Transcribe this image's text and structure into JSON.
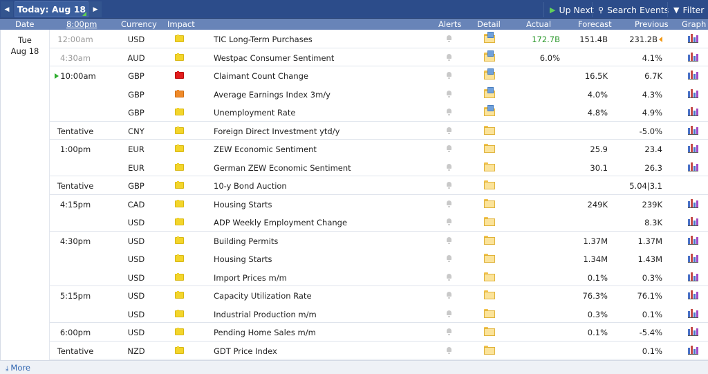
{
  "toolbar": {
    "prev_icon": "chevron-left-icon",
    "next_icon": "chevron-right-icon",
    "today_label": "Today: Aug 18",
    "up_next_label": "Up Next",
    "search_label": "Search Events",
    "filter_label": "Filter"
  },
  "header": {
    "date": "Date",
    "time": "8:00pm",
    "currency": "Currency",
    "impact": "Impact",
    "alerts": "Alerts",
    "detail": "Detail",
    "actual": "Actual",
    "forecast": "Forecast",
    "previous": "Previous",
    "graph": "Graph"
  },
  "day": {
    "weekday": "Tue",
    "date": "Aug 18"
  },
  "colors": {
    "impact_low": "#f3d52b",
    "impact_medium": "#ef8a2a",
    "impact_high": "#e21d1d",
    "actual_better": "#2f9a2f"
  },
  "events": [
    {
      "time": "12:00am",
      "time_muted": true,
      "currency": "USD",
      "impact": "low",
      "event": "TIC Long-Term Purchases",
      "detail": "doc",
      "actual": "172.7B",
      "actual_color": "green",
      "forecast": "151.4B",
      "previous": "231.2B",
      "prev_flag": true,
      "graph": true,
      "group_end": true
    },
    {
      "time": "4:30am",
      "time_muted": true,
      "currency": "AUD",
      "impact": "low",
      "event": "Westpac Consumer Sentiment",
      "detail": "doc",
      "actual": "6.0%",
      "forecast": "",
      "previous": "4.1%",
      "graph": true,
      "group_end": true
    },
    {
      "time": "10:00am",
      "play": true,
      "currency": "GBP",
      "impact": "high",
      "event": "Claimant Count Change",
      "detail": "doc",
      "actual": "",
      "forecast": "16.5K",
      "previous": "6.7K",
      "graph": true
    },
    {
      "time": "",
      "currency": "GBP",
      "impact": "med",
      "event": "Average Earnings Index 3m/y",
      "detail": "doc",
      "actual": "",
      "forecast": "4.0%",
      "previous": "4.3%",
      "graph": true
    },
    {
      "time": "",
      "currency": "GBP",
      "impact": "low",
      "event": "Unemployment Rate",
      "detail": "doc",
      "actual": "",
      "forecast": "4.8%",
      "previous": "4.9%",
      "graph": true,
      "group_end": true
    },
    {
      "time": "Tentative",
      "currency": "CNY",
      "impact": "low",
      "event": "Foreign Direct Investment ytd/y",
      "detail": "folder",
      "actual": "",
      "forecast": "",
      "previous": "-5.0%",
      "graph": true,
      "group_end": true
    },
    {
      "time": "1:00pm",
      "currency": "EUR",
      "impact": "low",
      "event": "ZEW Economic Sentiment",
      "detail": "folder",
      "actual": "",
      "forecast": "25.9",
      "previous": "23.4",
      "graph": true
    },
    {
      "time": "",
      "currency": "EUR",
      "impact": "low",
      "event": "German ZEW Economic Sentiment",
      "detail": "folder",
      "actual": "",
      "forecast": "30.1",
      "previous": "26.3",
      "graph": true,
      "group_end": true
    },
    {
      "time": "Tentative",
      "currency": "GBP",
      "impact": "low",
      "event": "10-y Bond Auction",
      "detail": "folder",
      "actual": "",
      "forecast": "",
      "previous": "5.04|3.1",
      "graph": false,
      "group_end": true
    },
    {
      "time": "4:15pm",
      "currency": "CAD",
      "impact": "low",
      "event": "Housing Starts",
      "detail": "folder",
      "actual": "",
      "forecast": "249K",
      "previous": "239K",
      "graph": true
    },
    {
      "time": "",
      "currency": "USD",
      "impact": "low",
      "event": "ADP Weekly Employment Change",
      "detail": "folder",
      "actual": "",
      "forecast": "",
      "previous": "8.3K",
      "graph": true,
      "group_end": true
    },
    {
      "time": "4:30pm",
      "currency": "USD",
      "impact": "low",
      "event": "Building Permits",
      "detail": "folder",
      "actual": "",
      "forecast": "1.37M",
      "previous": "1.37M",
      "graph": true
    },
    {
      "time": "",
      "currency": "USD",
      "impact": "low",
      "event": "Housing Starts",
      "detail": "folder",
      "actual": "",
      "forecast": "1.34M",
      "previous": "1.43M",
      "graph": true
    },
    {
      "time": "",
      "currency": "USD",
      "impact": "low",
      "event": "Import Prices m/m",
      "detail": "folder",
      "actual": "",
      "forecast": "0.1%",
      "previous": "0.3%",
      "graph": true,
      "group_end": true
    },
    {
      "time": "5:15pm",
      "currency": "USD",
      "impact": "low",
      "event": "Capacity Utilization Rate",
      "detail": "folder",
      "actual": "",
      "forecast": "76.3%",
      "previous": "76.1%",
      "graph": true
    },
    {
      "time": "",
      "currency": "USD",
      "impact": "low",
      "event": "Industrial Production m/m",
      "detail": "folder",
      "actual": "",
      "forecast": "0.3%",
      "previous": "0.1%",
      "graph": true,
      "group_end": true
    },
    {
      "time": "6:00pm",
      "currency": "USD",
      "impact": "low",
      "event": "Pending Home Sales m/m",
      "detail": "folder",
      "actual": "",
      "forecast": "0.1%",
      "previous": "-5.4%",
      "graph": true,
      "group_end": true
    },
    {
      "time": "Tentative",
      "currency": "NZD",
      "impact": "low",
      "event": "GDT Price Index",
      "detail": "folder",
      "actual": "",
      "forecast": "",
      "previous": "0.1%",
      "graph": true,
      "group_end": true
    }
  ],
  "footer": {
    "more_label": "More"
  }
}
